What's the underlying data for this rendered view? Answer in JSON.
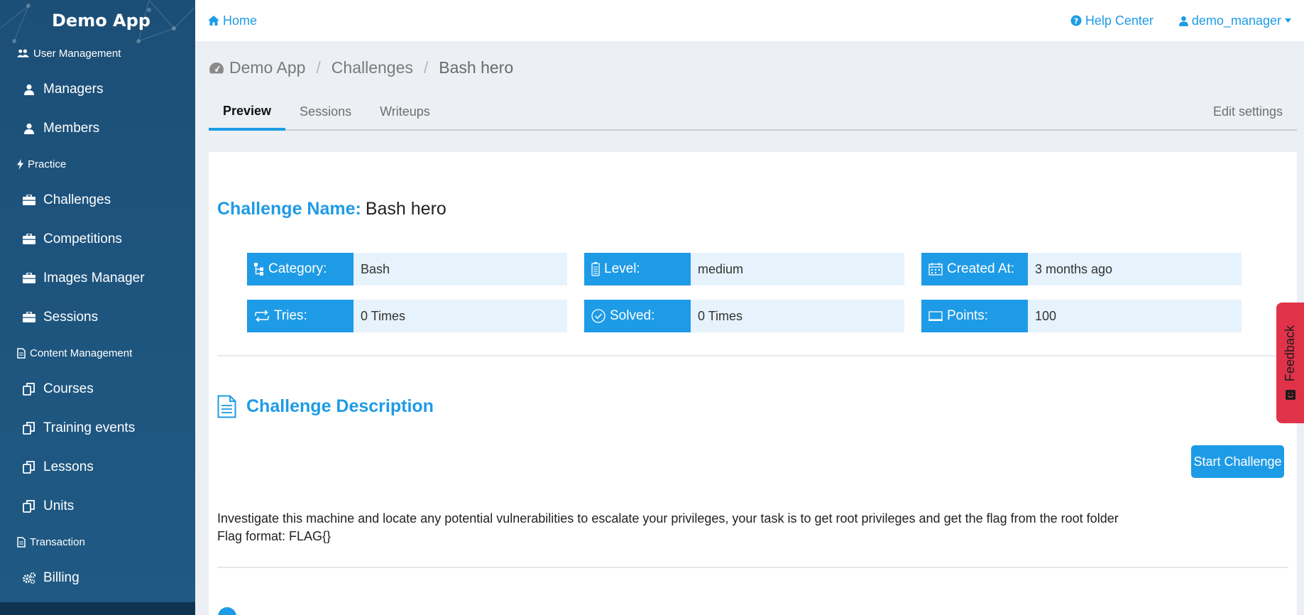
{
  "brand": {
    "name": "Demo App"
  },
  "sidebar": {
    "sections": [
      {
        "label": "User Management",
        "icon": "users-icon",
        "items": [
          {
            "label": "Managers",
            "icon": "user-icon"
          },
          {
            "label": "Members",
            "icon": "user-icon"
          }
        ]
      },
      {
        "label": "Practice",
        "icon": "bolt-icon",
        "items": [
          {
            "label": "Challenges",
            "icon": "briefcase-icon"
          },
          {
            "label": "Competitions",
            "icon": "briefcase-icon"
          },
          {
            "label": "Images Manager",
            "icon": "briefcase-icon"
          },
          {
            "label": "Sessions",
            "icon": "briefcase-icon"
          }
        ]
      },
      {
        "label": "Content Management",
        "icon": "document-icon",
        "items": [
          {
            "label": "Courses",
            "icon": "copy-icon"
          },
          {
            "label": "Training events",
            "icon": "copy-icon"
          },
          {
            "label": "Lessons",
            "icon": "copy-icon"
          },
          {
            "label": "Units",
            "icon": "copy-icon"
          }
        ]
      },
      {
        "label": "Transaction",
        "icon": "document-icon",
        "items": [
          {
            "label": "Billing",
            "icon": "cogs-icon"
          }
        ]
      }
    ]
  },
  "topbar": {
    "home": "Home",
    "help": "Help Center",
    "user": "demo_manager"
  },
  "breadcrumb": {
    "root": "Demo App",
    "section": "Challenges",
    "current": "Bash hero"
  },
  "tabs": {
    "preview": "Preview",
    "sessions": "Sessions",
    "writeups": "Writeups",
    "edit": "Edit settings"
  },
  "challenge": {
    "name_label": "Challenge Name:",
    "name": "Bash hero",
    "info": {
      "category": {
        "label": "Category:",
        "value": "Bash"
      },
      "level": {
        "label": "Level:",
        "value": "medium"
      },
      "created": {
        "label": "Created At:",
        "value": "3 months ago"
      },
      "tries": {
        "label": "Tries:",
        "value": "0 Times"
      },
      "solved": {
        "label": "Solved:",
        "value": "0 Times"
      },
      "points": {
        "label": "Points:",
        "value": "100"
      }
    },
    "description_title": "Challenge Description",
    "start_button": "Start Challenge",
    "description_line1": "Investigate this machine and locate any potential vulnerabilities to escalate your privileges, your task is to get root privileges and get the flag from the root folder",
    "description_line2": "Flag format: FLAG{}"
  },
  "feedback": {
    "label": "Feedback"
  },
  "colors": {
    "accent": "#1e9be6",
    "sidebar": "#1c4f78",
    "feedback": "#e0334a",
    "info_bg": "#e6f3fc"
  }
}
